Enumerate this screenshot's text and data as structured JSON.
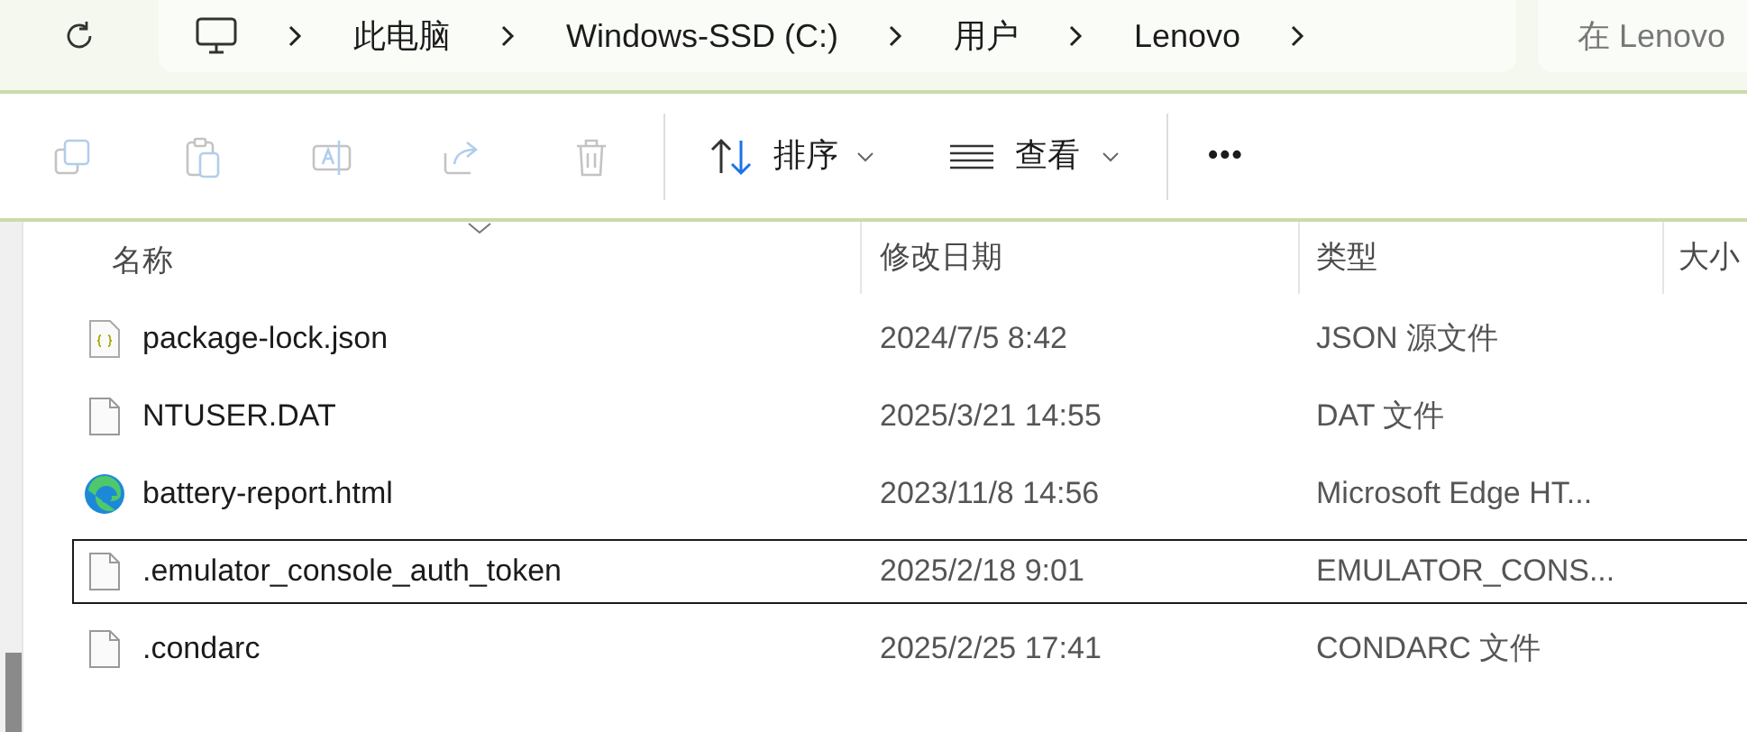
{
  "address_bar": {
    "segments": [
      "此电脑",
      "Windows-SSD (C:)",
      "用户",
      "Lenovo"
    ]
  },
  "search": {
    "placeholder": "在 Lenovo"
  },
  "toolbar": {
    "buttons": [
      {
        "kind": "copy",
        "disabled": true
      },
      {
        "kind": "paste",
        "disabled": true
      },
      {
        "kind": "rename",
        "disabled": true
      },
      {
        "kind": "share",
        "disabled": true
      },
      {
        "kind": "delete",
        "disabled": true
      }
    ],
    "sort_label": "排序",
    "view_label": "查看",
    "more": "•••"
  },
  "table": {
    "columns": [
      "名称",
      "修改日期",
      "类型",
      "大小"
    ],
    "rows": [
      {
        "kind": "json",
        "name": "package-lock.json",
        "modified": "2024/7/5 8:42",
        "type": "JSON 源文件",
        "focused": false
      },
      {
        "kind": "file",
        "name": "NTUSER.DAT",
        "modified": "2025/3/21 14:55",
        "type": "DAT 文件",
        "focused": false
      },
      {
        "kind": "edge",
        "name": "battery-report.html",
        "modified": "2023/11/8 14:56",
        "type": "Microsoft Edge HT...",
        "focused": false
      },
      {
        "kind": "file",
        "name": ".emulator_console_auth_token",
        "modified": "2025/2/18 9:01",
        "type": "EMULATOR_CONS...",
        "focused": true
      },
      {
        "kind": "file",
        "name": ".condarc",
        "modified": "2025/2/25 17:41",
        "type": "CONDARC 文件",
        "focused": false
      }
    ]
  }
}
